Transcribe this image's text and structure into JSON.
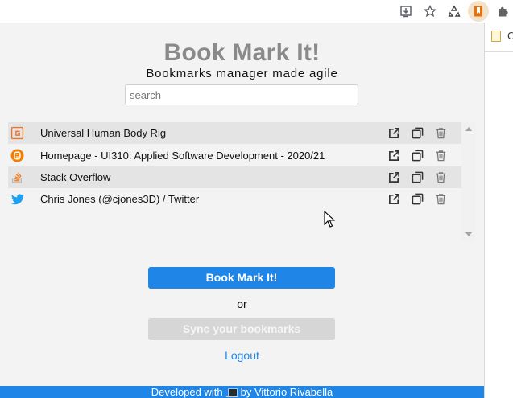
{
  "browser": {
    "toolbar_icons": [
      "install-app-icon",
      "star-icon",
      "recycle-extension-icon",
      "bookmark-extension-icon",
      "puzzle-extensions-icon"
    ],
    "page_strip_text": "C"
  },
  "popup": {
    "title": "Book Mark It!",
    "subtitle": "Bookmarks manager made agile",
    "search": {
      "placeholder": "search",
      "value": ""
    },
    "bookmarks": [
      {
        "title": "Universal Human Body Rig",
        "icon": "gumroad-favicon"
      },
      {
        "title": "Homepage - UI310: Applied Software Development - 2020/21",
        "icon": "blogger-favicon"
      },
      {
        "title": "Stack Overflow",
        "icon": "stackoverflow-favicon"
      },
      {
        "title": "Chris Jones (@cjones3D) / Twitter",
        "icon": "twitter-favicon"
      }
    ],
    "bookmark_button": "Book Mark It!",
    "or_text": "or",
    "sync_button": "Sync your bookmarks",
    "logout_link": "Logout",
    "footer": {
      "prefix": "Developed with",
      "suffix": "by Vittorio Rivabella"
    }
  },
  "colors": {
    "accent": "#1f86e8",
    "title_gray": "#8a8a8a",
    "disabled_button": "#d6d6d6",
    "row_shade": "#e4e4e4",
    "popup_bg": "#f3f3f3"
  }
}
